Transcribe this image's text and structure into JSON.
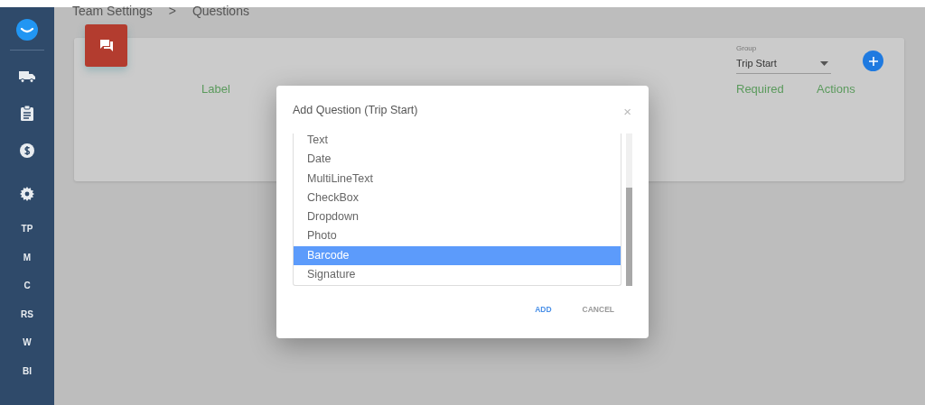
{
  "breadcrumb": {
    "parent": "Team Settings",
    "separator": ">",
    "current": "Questions"
  },
  "sidebar": {
    "items": [
      {
        "kind": "truck"
      },
      {
        "kind": "clipboard"
      },
      {
        "kind": "dollar"
      },
      {
        "kind": "gear"
      },
      {
        "kind": "text",
        "label": "TP"
      },
      {
        "kind": "text",
        "label": "M"
      },
      {
        "kind": "text",
        "label": "C"
      },
      {
        "kind": "text",
        "label": "RS"
      },
      {
        "kind": "text",
        "label": "W"
      },
      {
        "kind": "text",
        "label": "BI"
      }
    ]
  },
  "card": {
    "group": {
      "label": "Group",
      "value": "Trip Start"
    },
    "columns": [
      "Label",
      "Required",
      "Actions"
    ]
  },
  "dialog": {
    "title": "Add Question (Trip Start)",
    "close": "×",
    "options": [
      {
        "label": "Text",
        "selected": false
      },
      {
        "label": "Date",
        "selected": false
      },
      {
        "label": "MultiLineText",
        "selected": false
      },
      {
        "label": "CheckBox",
        "selected": false
      },
      {
        "label": "Dropdown",
        "selected": false
      },
      {
        "label": "Photo",
        "selected": false
      },
      {
        "label": "Barcode",
        "selected": true
      },
      {
        "label": "Signature",
        "selected": false
      }
    ],
    "buttons": [
      {
        "label": "ADD",
        "kind": "primary"
      },
      {
        "label": "CANCEL",
        "kind": "secondary"
      }
    ]
  }
}
